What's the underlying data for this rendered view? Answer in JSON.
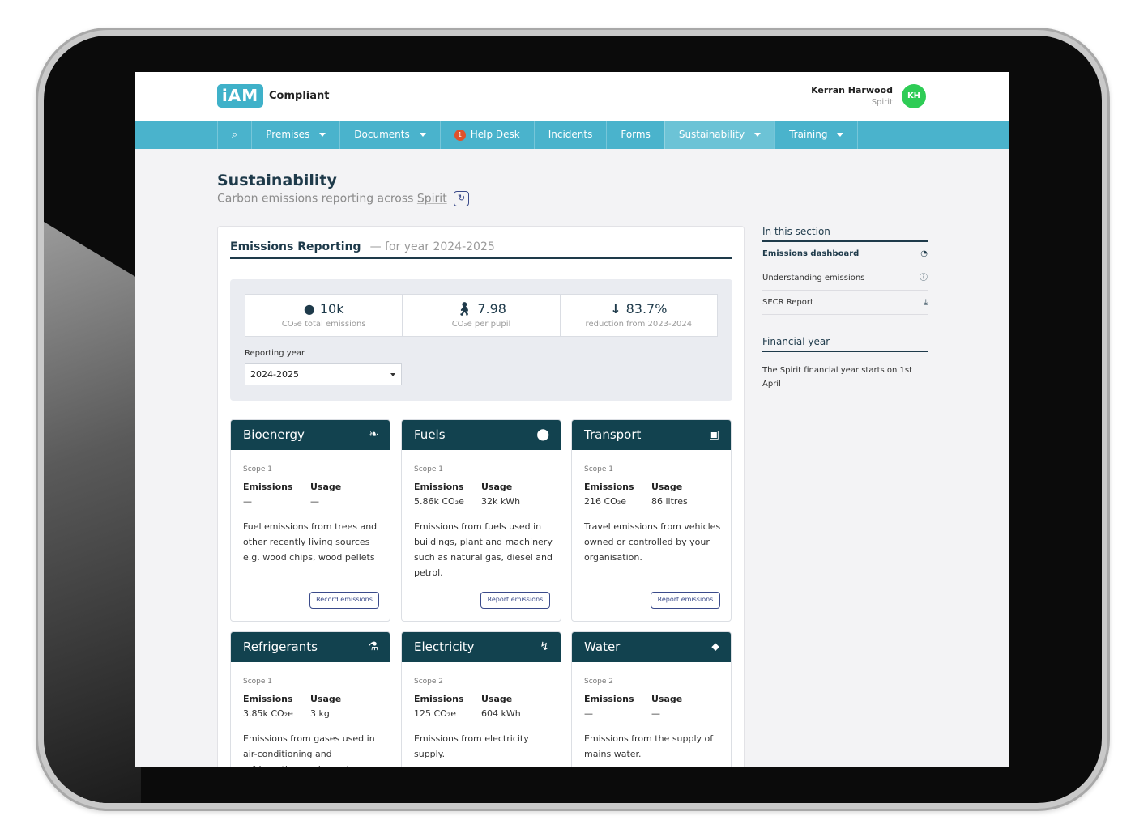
{
  "header": {
    "logo": "iAM",
    "app_name": "Compliant",
    "user_name": "Kerran Harwood",
    "user_org": "Spirit",
    "avatar_initials": "KH"
  },
  "nav": {
    "search_icon": "search-icon",
    "items": [
      {
        "label": "Premises",
        "dropdown": true
      },
      {
        "label": "Documents",
        "dropdown": true
      },
      {
        "label": "Help Desk",
        "badge": "1"
      },
      {
        "label": "Incidents"
      },
      {
        "label": "Forms"
      },
      {
        "label": "Sustainability",
        "dropdown": true,
        "active": true
      },
      {
        "label": "Training",
        "dropdown": true
      }
    ]
  },
  "page": {
    "title": "Sustainability",
    "subtitle_prefix": "Carbon emissions reporting across",
    "subtitle_org": "Spirit"
  },
  "panel": {
    "title": "Emissions Reporting",
    "year_text": "— for year 2024-2025",
    "stats": [
      {
        "icon": "globe-icon",
        "value": "10k",
        "label": "CO₂e total emissions"
      },
      {
        "icon": "pupil-icon",
        "value": "7.98",
        "label": "CO₂e per pupil"
      },
      {
        "icon": "arrow-down-icon",
        "value": "83.7%",
        "label": "reduction from 2023-2024"
      }
    ],
    "reporting_year_label": "Reporting year",
    "reporting_year_value": "2024-2025"
  },
  "cards": [
    {
      "title": "Bioenergy",
      "icon": "leaf-icon",
      "scope": "Scope 1",
      "emissions_label": "Emissions",
      "usage_label": "Usage",
      "emissions": "—",
      "usage": "—",
      "description": "Fuel emissions from trees and other recently living sources e.g. wood chips, wood pellets",
      "button": "Record emissions"
    },
    {
      "title": "Fuels",
      "icon": "fuel-icon",
      "scope": "Scope 1",
      "emissions_label": "Emissions",
      "usage_label": "Usage",
      "emissions": "5.86k CO₂e",
      "usage": "32k kWh",
      "description": "Emissions from fuels used in buildings, plant and machinery such as natural gas, diesel and petrol.",
      "button": "Report emissions"
    },
    {
      "title": "Transport",
      "icon": "bus-icon",
      "scope": "Scope 1",
      "emissions_label": "Emissions",
      "usage_label": "Usage",
      "emissions": "216 CO₂e",
      "usage": "86 litres",
      "description": "Travel emissions from vehicles owned or controlled by your organisation.",
      "button": "Report emissions"
    },
    {
      "title": "Refrigerants",
      "icon": "flask-icon",
      "scope": "Scope 1",
      "emissions_label": "Emissions",
      "usage_label": "Usage",
      "emissions": "3.85k CO₂e",
      "usage": "3 kg",
      "description": "Emissions from gases used in air-conditioning and refrigeration equipment.",
      "button": ""
    },
    {
      "title": "Electricity",
      "icon": "bolt-icon",
      "scope": "Scope 2",
      "emissions_label": "Emissions",
      "usage_label": "Usage",
      "emissions": "125 CO₂e",
      "usage": "604 kWh",
      "description": "Emissions from electricity supply.",
      "button": ""
    },
    {
      "title": "Water",
      "icon": "drop-icon",
      "scope": "Scope 2",
      "emissions_label": "Emissions",
      "usage_label": "Usage",
      "emissions": "—",
      "usage": "—",
      "description": "Emissions from the supply of mains water.",
      "button": ""
    }
  ],
  "sidebar": {
    "section_title": "In this section",
    "items": [
      {
        "label": "Emissions dashboard",
        "icon": "dashboard-icon",
        "active": true
      },
      {
        "label": "Understanding emissions",
        "icon": "info-icon"
      },
      {
        "label": "SECR Report",
        "icon": "download-icon"
      }
    ],
    "financial_title": "Financial year",
    "financial_text": "The Spirit financial year starts on 1st April"
  }
}
